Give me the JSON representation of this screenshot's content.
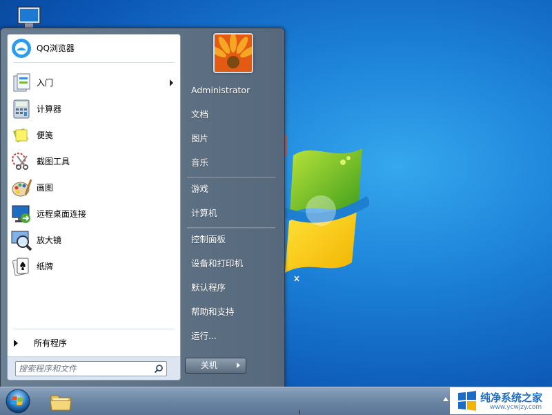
{
  "start_menu": {
    "programs": [
      {
        "label": "QQ浏览器",
        "icon": "qq-browser-icon"
      },
      {
        "label": "入门",
        "icon": "getting-started-icon",
        "has_submenu": true
      },
      {
        "label": "计算器",
        "icon": "calculator-icon"
      },
      {
        "label": "便笺",
        "icon": "sticky-notes-icon"
      },
      {
        "label": "截图工具",
        "icon": "snipping-tool-icon"
      },
      {
        "label": "画图",
        "icon": "paint-icon"
      },
      {
        "label": "远程桌面连接",
        "icon": "remote-desktop-icon"
      },
      {
        "label": "放大镜",
        "icon": "magnifier-icon"
      },
      {
        "label": "纸牌",
        "icon": "solitaire-icon"
      }
    ],
    "all_programs_label": "所有程序",
    "search": {
      "placeholder": "搜索程序和文件"
    },
    "right_items": [
      {
        "label": "Administrator"
      },
      {
        "label": "文档"
      },
      {
        "label": "图片"
      },
      {
        "label": "音乐"
      },
      {
        "label": "游戏"
      },
      {
        "label": "计算机"
      },
      {
        "label": "控制面板"
      },
      {
        "label": "设备和打印机"
      },
      {
        "label": "默认程序"
      },
      {
        "label": "帮助和支持"
      },
      {
        "label": "运行..."
      }
    ],
    "shutdown_label": "关机"
  },
  "watermark": {
    "title": "纯净系统之家",
    "url": "www.ycwjzy.com"
  },
  "colors": {
    "desktop": "#1b7fd6",
    "start_menu_frame": "#5f7285",
    "taskbar": "#6d88a6",
    "watermark_text": "#1a6cc7"
  }
}
